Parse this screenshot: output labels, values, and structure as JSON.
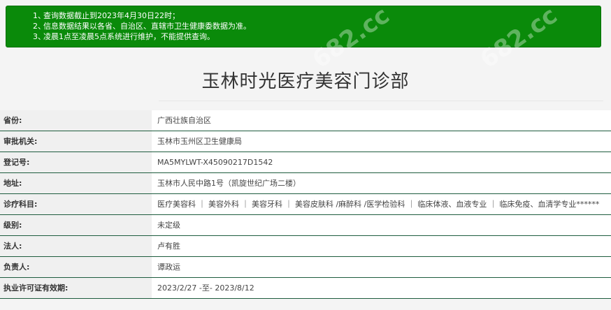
{
  "notice": {
    "items": [
      {
        "num": "1、",
        "text": "查询数据截止到2023年4月30日22时；"
      },
      {
        "num": "2、",
        "text": "信息数据结果以各省、自治区、直辖市卫生健康委数据为准。"
      },
      {
        "num": "3、",
        "text": "凌晨1点至凌晨5点系统进行维护，不能提供查询。"
      }
    ]
  },
  "page_title": "玉林时光医疗美容门诊部",
  "rows": [
    {
      "label": "省份:",
      "value": "广西壮族自治区"
    },
    {
      "label": "审批机关:",
      "value": "玉林市玉州区卫生健康局"
    },
    {
      "label": "登记号:",
      "value": "MA5MYLWT-X45090217D1542"
    },
    {
      "label": "地址:",
      "value": "玉林市人民中路1号（凯旋世纪广场二楼）"
    },
    {
      "label": "诊疗科目:",
      "value": "医疗美容科 ｜ 美容外科 ｜ 美容牙科 ｜ 美容皮肤科 /麻醉科 /医学检验科 ｜ 临床体液、血液专业 ｜ 临床免疫、血清学专业******"
    },
    {
      "label": "级别:",
      "value": "未定级"
    },
    {
      "label": "法人:",
      "value": "卢有胜"
    },
    {
      "label": "负责人:",
      "value": "谭政运"
    },
    {
      "label": "执业许可证有效期:",
      "value": "2023/2/27 -至- 2023/8/12"
    }
  ],
  "watermark": "682.cc"
}
